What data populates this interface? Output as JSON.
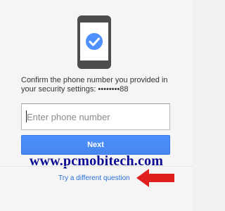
{
  "verification": {
    "prompt": "Confirm the phone number you provided in your security settings: ••••••••88",
    "phone_placeholder": "Enter phone number",
    "next_label": "Next",
    "alternate_link": "Try a different question"
  },
  "watermark": {
    "text": "www.pcmobitech.com"
  },
  "icons": {
    "illustration": "phone-checkmark-icon",
    "annotation": "red-arrow-left-icon"
  },
  "colors": {
    "accent": "#4d90fe",
    "link": "#2a6fd6",
    "watermark": "#0a0a96",
    "arrow": "#e0201f",
    "phone_body": "#4d4d4d",
    "screen": "#ffffff"
  }
}
